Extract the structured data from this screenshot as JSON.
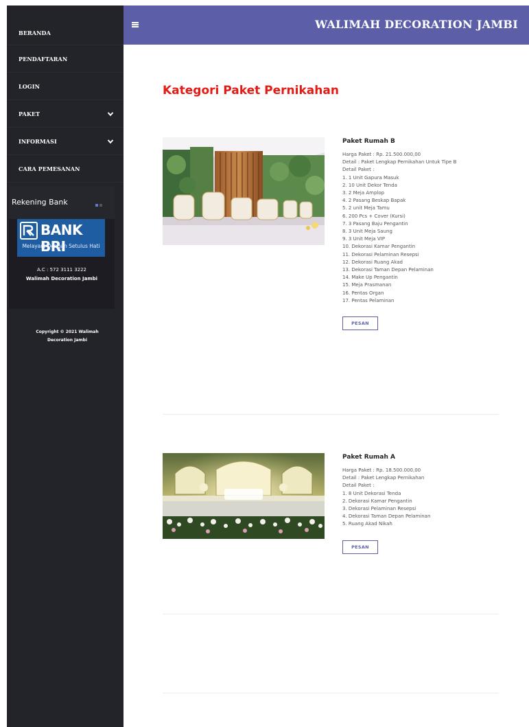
{
  "sidebar": {
    "items": [
      {
        "label": "BERANDA",
        "has_dropdown": false
      },
      {
        "label": "PENDAFTARAN",
        "has_dropdown": false
      },
      {
        "label": "LOGIN",
        "has_dropdown": false
      },
      {
        "label": "PAKET",
        "has_dropdown": true
      },
      {
        "label": "INFORMASI",
        "has_dropdown": true
      },
      {
        "label": "CARA PEMESANAN",
        "has_dropdown": false
      }
    ],
    "bank": {
      "title": "Rekening Bank",
      "logo_text": "BANK BRI",
      "logo_tagline": "Melayani Dengan Setulus Hati",
      "account": "A.C : 572 3111 3222",
      "account_name": "Walimah Decoration Jambi"
    },
    "copyright": "Copyright © 2021 Walimah Decoration Jambi"
  },
  "header": {
    "menu_icon": "hamburger-icon",
    "title": "WALIMAH DECORATION JAMBI"
  },
  "main": {
    "title": "Kategori Paket Pernikahan",
    "products": [
      {
        "name": "Paket Rumah B",
        "price": "Harga Paket : Rp. 21.500.000,00",
        "detail": "Detail : Paket Lengkap Pernikahan Untuk Tipe B",
        "detail_label": "Detail Paket :",
        "items": [
          "1. 1 Unit Gapura Masuk",
          "2. 10 Unit Dekor Tenda",
          "3. 2 Meja Amplop",
          "4. 2 Pasang Beskap Bapak",
          "5. 2 unit Meja Tamu",
          "6. 200 Pcs + Cover (Kursi)",
          "7. 3 Pasang Baju Pengantin",
          "8. 3 Unit Meja Saung",
          "9. 3 Unit Meja VIP",
          "10. Dekorasi Kamar Pengantin",
          "11. Dekorasi Pelaminan Resepsi",
          "12. Dekorasi Ruang Akad",
          "13. Dekorasi Taman Depan Pelaminan",
          "14. Make Up Pengantin",
          "15. Meja Prasmanan",
          "16. Pentas Organ",
          "17. Pentas Pelaminan"
        ],
        "button": "PESAN"
      },
      {
        "name": "Paket Rumah A",
        "price": "Harga Paket : Rp. 18.500.000,00",
        "detail": "Detail : Paket Lengkap Pernikahan",
        "detail_label": "Detail Paket :",
        "items": [
          "1. 8 Unit Dekorasi Tenda",
          "2. Dekorasi Kamar Pengantin",
          "3. Dekorasi Pelaminan Resepsi",
          "4. Dekorasi Taman Depan Pelaminan",
          "5. Ruang Akad Nikah"
        ],
        "button": "PESAN"
      }
    ]
  },
  "colors": {
    "sidebar_bg": "#23232a",
    "topbar_bg": "#5c5fa8",
    "title_red": "#e41b14",
    "bri_blue": "#1f5da3"
  }
}
